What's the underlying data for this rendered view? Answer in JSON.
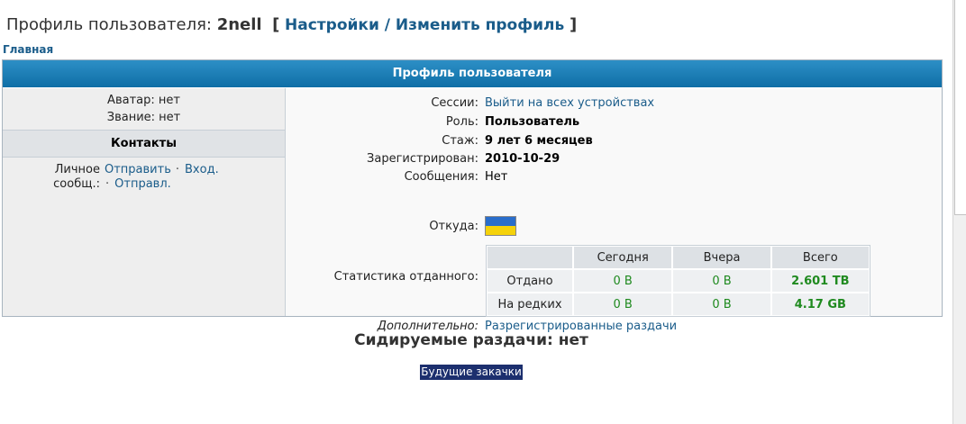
{
  "header": {
    "title_prefix": "Профиль пользователя:",
    "username": "2nell",
    "bracket_open": "[",
    "settings_link": "Настройки / Изменить профиль",
    "bracket_close": "]"
  },
  "breadcrumb": {
    "home": "Главная"
  },
  "profile": {
    "heading": "Профиль пользователя",
    "avatar": "Аватар: нет",
    "rank": "Звание: нет",
    "contacts_heading": "Контакты",
    "pm_label_line1": "Личное",
    "pm_label_line2": "сообщ.:",
    "pm_send": "Отправить",
    "pm_inbox": "Вход.",
    "pm_sent": "Отправл.",
    "pm_sep": "·",
    "sessions_label": "Сессии:",
    "sessions_link": "Выйти на всех устройствах",
    "role_label": "Роль:",
    "role_value": "Пользователь",
    "tenure_label": "Стаж:",
    "tenure_value": "9 лет 6 месяцев",
    "registered_label": "Зарегистрирован:",
    "registered_value": "2010-10-29",
    "messages_label": "Сообщения:",
    "messages_value": "Нет",
    "from_label": "Откуда:",
    "flag_icon": "ukraine-flag-icon",
    "stats_label": "Статистика отданного:",
    "stats": {
      "headers": [
        "",
        "Сегодня",
        "Вчера",
        "Всего"
      ],
      "rows": [
        {
          "label": "Отдано",
          "today": "0 B",
          "yesterday": "0 B",
          "total": "2.601 TB"
        },
        {
          "label": "На редких",
          "today": "0 B",
          "yesterday": "0 B",
          "total": "4.17 GB"
        }
      ]
    },
    "extra_label": "Дополнительно:",
    "extra_link": "Разрегистрированные раздачи"
  },
  "seeding": {
    "title": "Сидируемые раздачи: нет",
    "future_button": "Будущие закачки"
  },
  "colors": {
    "header_blue": "#1471ab",
    "link_blue": "#1a5c8a",
    "green_value": "#1f8a1f",
    "button_navy": "#1c2f6e"
  }
}
